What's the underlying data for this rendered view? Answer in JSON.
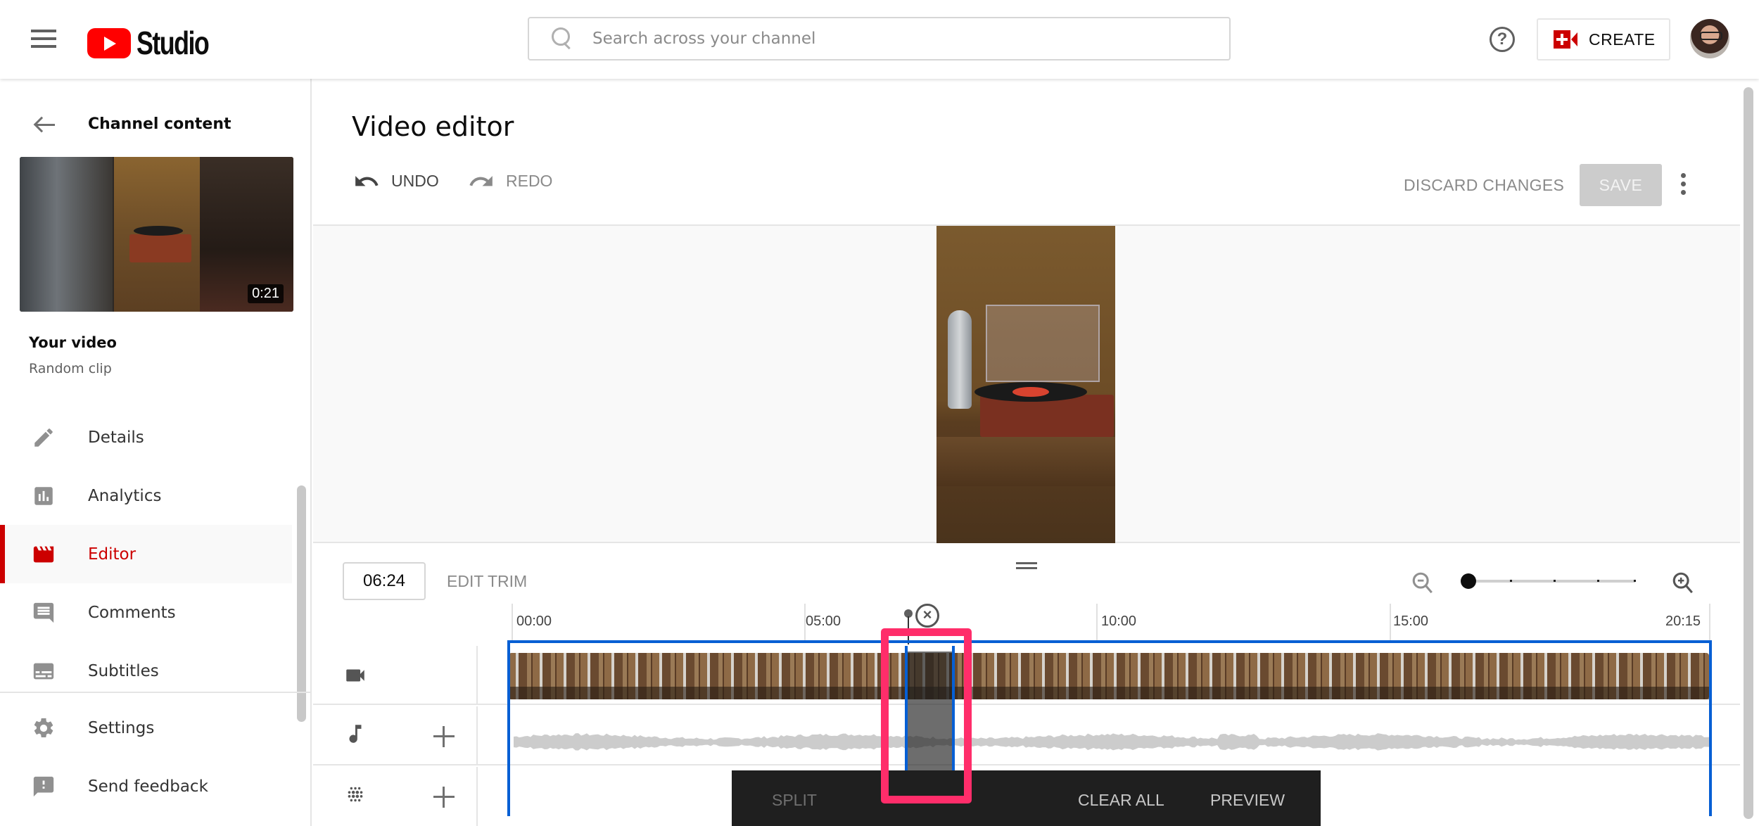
{
  "header": {
    "app_name": "Studio",
    "search_placeholder": "Search across your channel",
    "create_label": "CREATE"
  },
  "sidebar": {
    "back_label": "Channel content",
    "thumbnail_duration": "0:21",
    "video_heading": "Your video",
    "video_title": "Random clip",
    "items": [
      {
        "label": "Details",
        "icon": "pencil-icon",
        "active": false
      },
      {
        "label": "Analytics",
        "icon": "analytics-icon",
        "active": false
      },
      {
        "label": "Editor",
        "icon": "clapperboard-icon",
        "active": true
      },
      {
        "label": "Comments",
        "icon": "comment-icon",
        "active": false
      },
      {
        "label": "Subtitles",
        "icon": "subtitles-icon",
        "active": false
      }
    ],
    "bottom_items": [
      {
        "label": "Settings",
        "icon": "gear-icon"
      },
      {
        "label": "Send feedback",
        "icon": "feedback-icon"
      }
    ]
  },
  "editor": {
    "title": "Video editor",
    "undo_label": "UNDO",
    "redo_label": "REDO",
    "discard_label": "DISCARD CHANGES",
    "save_label": "SAVE",
    "current_time": "06:24",
    "edit_trim_label": "EDIT TRIM",
    "zoom_level_index": 0,
    "zoom_level_count": 5,
    "ruler_labels": [
      "00:00",
      "05:00",
      "10:00",
      "15:00",
      "20:15"
    ],
    "cut_region": {
      "start_fraction": 0.331,
      "end_fraction": 0.37
    },
    "actions": {
      "split_label": "SPLIT",
      "clear_all_label": "CLEAR ALL",
      "preview_label": "PREVIEW"
    }
  },
  "colors": {
    "brand_red": "#ff0000",
    "active_red": "#cc0000",
    "trim_blue": "#065fd4",
    "highlight_pink": "#ff2d6a"
  }
}
